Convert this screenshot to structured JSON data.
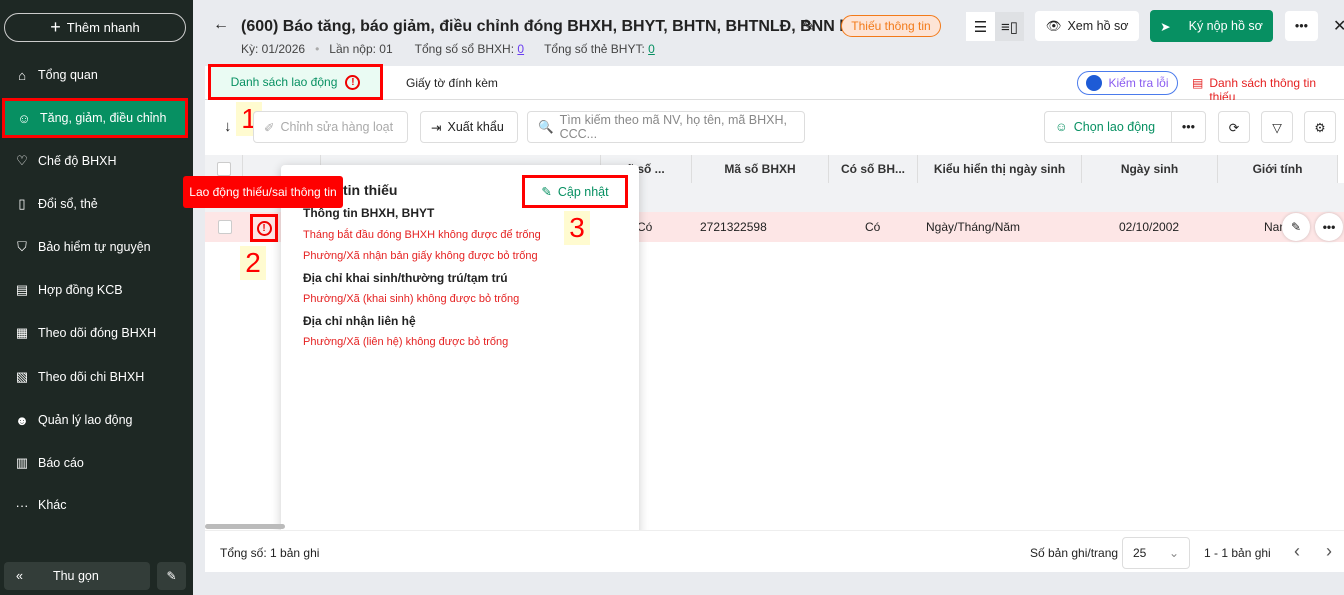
{
  "sidebar": {
    "quick_add": "Thêm nhanh",
    "items": [
      {
        "label": "Tổng quan",
        "icon": "home-icon"
      },
      {
        "label": "Tăng, giảm, điều chỉnh",
        "icon": "user-adjust-icon"
      },
      {
        "label": "Chế độ BHXH",
        "icon": "shield-heart-icon"
      },
      {
        "label": "Đổi sổ, thẻ",
        "icon": "document-icon"
      },
      {
        "label": "Bảo hiểm tự nguyện",
        "icon": "shield-icon"
      },
      {
        "label": "Hợp đồng KCB",
        "icon": "contract-icon"
      },
      {
        "label": "Theo dõi đóng BHXH",
        "icon": "calendar-icon"
      },
      {
        "label": "Theo dõi chi BHXH",
        "icon": "payment-icon"
      },
      {
        "label": "Quản lý lao động",
        "icon": "users-icon"
      },
      {
        "label": "Báo cáo",
        "icon": "report-icon"
      },
      {
        "label": "Khác",
        "icon": "more-icon"
      }
    ],
    "collapse": "Thu gọn"
  },
  "header": {
    "title": "(600) Báo tăng, báo giảm, điều chỉnh đóng BHXH, BHYT, BHTN, BHTNLĐ, BNN k...",
    "period": "Kỳ: 01/2026",
    "submission": "Lần nộp: 01",
    "bhxh_label": "Tổng số sổ BHXH:",
    "bhxh_count": "0",
    "bhyt_label": "Tổng số thẻ BHYT:",
    "bhyt_count": "0",
    "status": "Thiếu thông tin",
    "view": "Xem hồ sơ",
    "submit": "Ký nộp hồ sơ",
    "more": "•••"
  },
  "tabs": {
    "employees": "Danh sách lao động",
    "attachments": "Giấy tờ đính kèm",
    "check_errors": "Kiểm tra lỗi",
    "missing_list": "Danh sách thông tin thiếu"
  },
  "annotations": [
    "1",
    "2",
    "3"
  ],
  "toolbar": {
    "bulk_edit": "Chỉnh sửa hàng loạt",
    "export": "Xuất khẩu",
    "search_placeholder": "Tìm kiếm theo mã NV, họ tên, mã BHXH, CCC...",
    "choose": "Chọn lao động"
  },
  "table": {
    "columns": [
      "ã số ...",
      "Mã số BHXH",
      "Có số BH...",
      "Kiểu hiển thị ngày sinh",
      "Ngày sinh",
      "Giới tính"
    ],
    "row": [
      "Có",
      "2721322598",
      "Có",
      "Ngày/Tháng/Năm",
      "02/10/2002",
      "Nam"
    ]
  },
  "tooltip": "Lao động thiếu/sai thông tin",
  "popup": {
    "title": "tin thiếu",
    "update": "Cập nhật",
    "sections": [
      {
        "heading": "Thông tin BHXH, BHYT",
        "errors": [
          "Tháng bắt đầu đóng BHXH không được để trống",
          "Phường/Xã nhận bản giấy không được bỏ trống"
        ]
      },
      {
        "heading": "Địa chỉ khai sinh/thường trú/tạm trú",
        "errors": [
          "Phường/Xã (khai sinh) không được bỏ trống"
        ]
      },
      {
        "heading": "Địa chỉ nhận liên hệ",
        "errors": [
          "Phường/Xã (liên hệ) không được bỏ trống"
        ]
      }
    ]
  },
  "footer": {
    "total": "Tổng số: 1 bản ghi",
    "per_page_label": "Số bản ghi/trang",
    "per_page": "25",
    "range": "1 - 1 bản ghi"
  }
}
